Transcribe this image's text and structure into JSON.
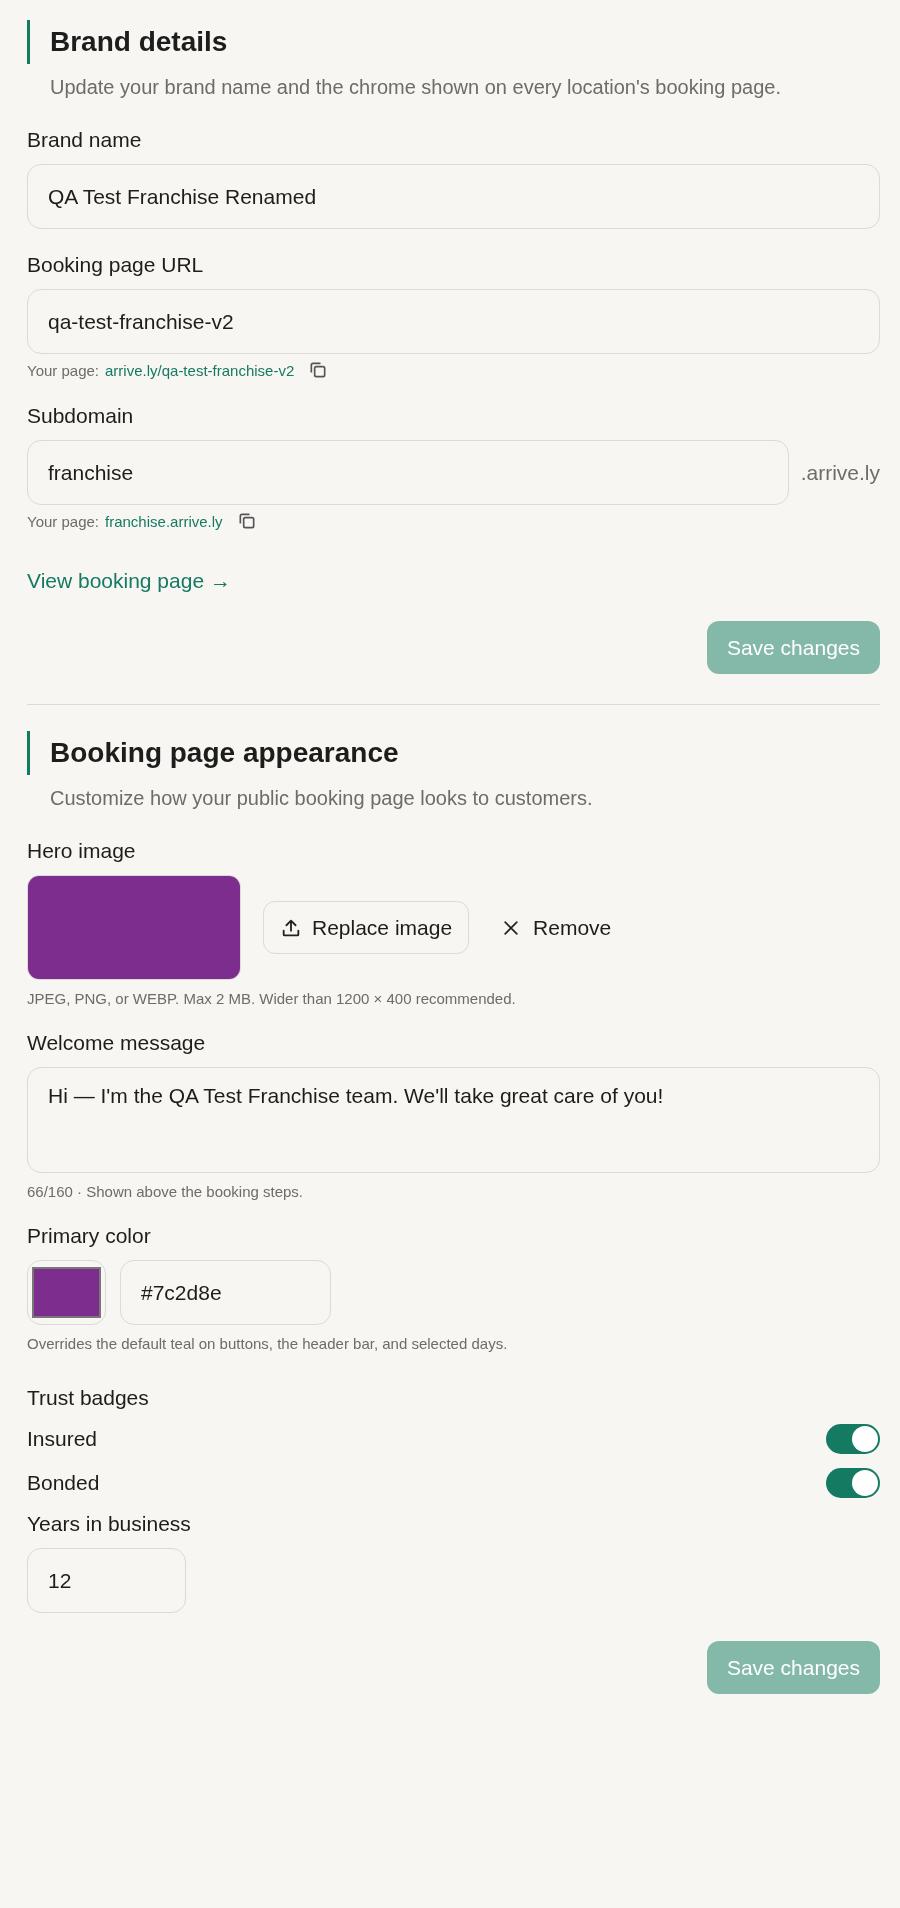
{
  "sections": [
    {
      "title": "Brand details",
      "subtitle": "Update your brand name and the chrome shown on every location's booking page.",
      "fields": [
        {
          "kind": "text",
          "label": "Brand name",
          "value": "QA Test Franchise Renamed"
        },
        {
          "kind": "text",
          "label": "Booking page URL",
          "value": "qa-test-franchise-v2",
          "hint_prefix": "Your page:",
          "hint_link": "arrive.ly/qa-test-franchise-v2"
        },
        {
          "kind": "suffix",
          "label": "Subdomain",
          "value": "franchise",
          "suffix": ".arrive.ly",
          "hint_prefix": "Your page:",
          "hint_link": "franchise.arrive.ly"
        },
        {
          "kind": "link",
          "text": "View booking page →"
        }
      ],
      "save_button": {
        "label": "Save changes",
        "disabled": true
      }
    },
    {
      "title": "Booking page appearance",
      "subtitle": "Customize how your public booking page looks to customers.",
      "fields": [
        {
          "label": "Hero image",
          "replace_button": "Replace image",
          "remove_button": "Remove",
          "hint": "JPEG, PNG, or WEBP. Max 2 MB. Wider than 1200 × 400 recommended."
        },
        {
          "kind": "textarea",
          "label": "Welcome message",
          "value": "Hi — I'm the QA Test Franchise team. We'll take great care of you!",
          "hint": "66/160 · Shown above the booking steps."
        },
        {
          "kind": "color",
          "label": "Primary color",
          "color": "#7c2d8e",
          "value": "#7c2d8e",
          "hint": "Overrides the default teal on buttons, the header bar, and selected days."
        },
        {
          "kind": "heading",
          "label": "Trust badges"
        },
        {
          "kind": "toggle",
          "label": "Insured",
          "on": true
        },
        {
          "kind": "toggle",
          "label": "Bonded",
          "on": true
        },
        {
          "kind": "small",
          "label": "Years in business",
          "value": "12"
        }
      ],
      "save_button": {
        "label": "Save changes",
        "disabled": true
      }
    }
  ]
}
